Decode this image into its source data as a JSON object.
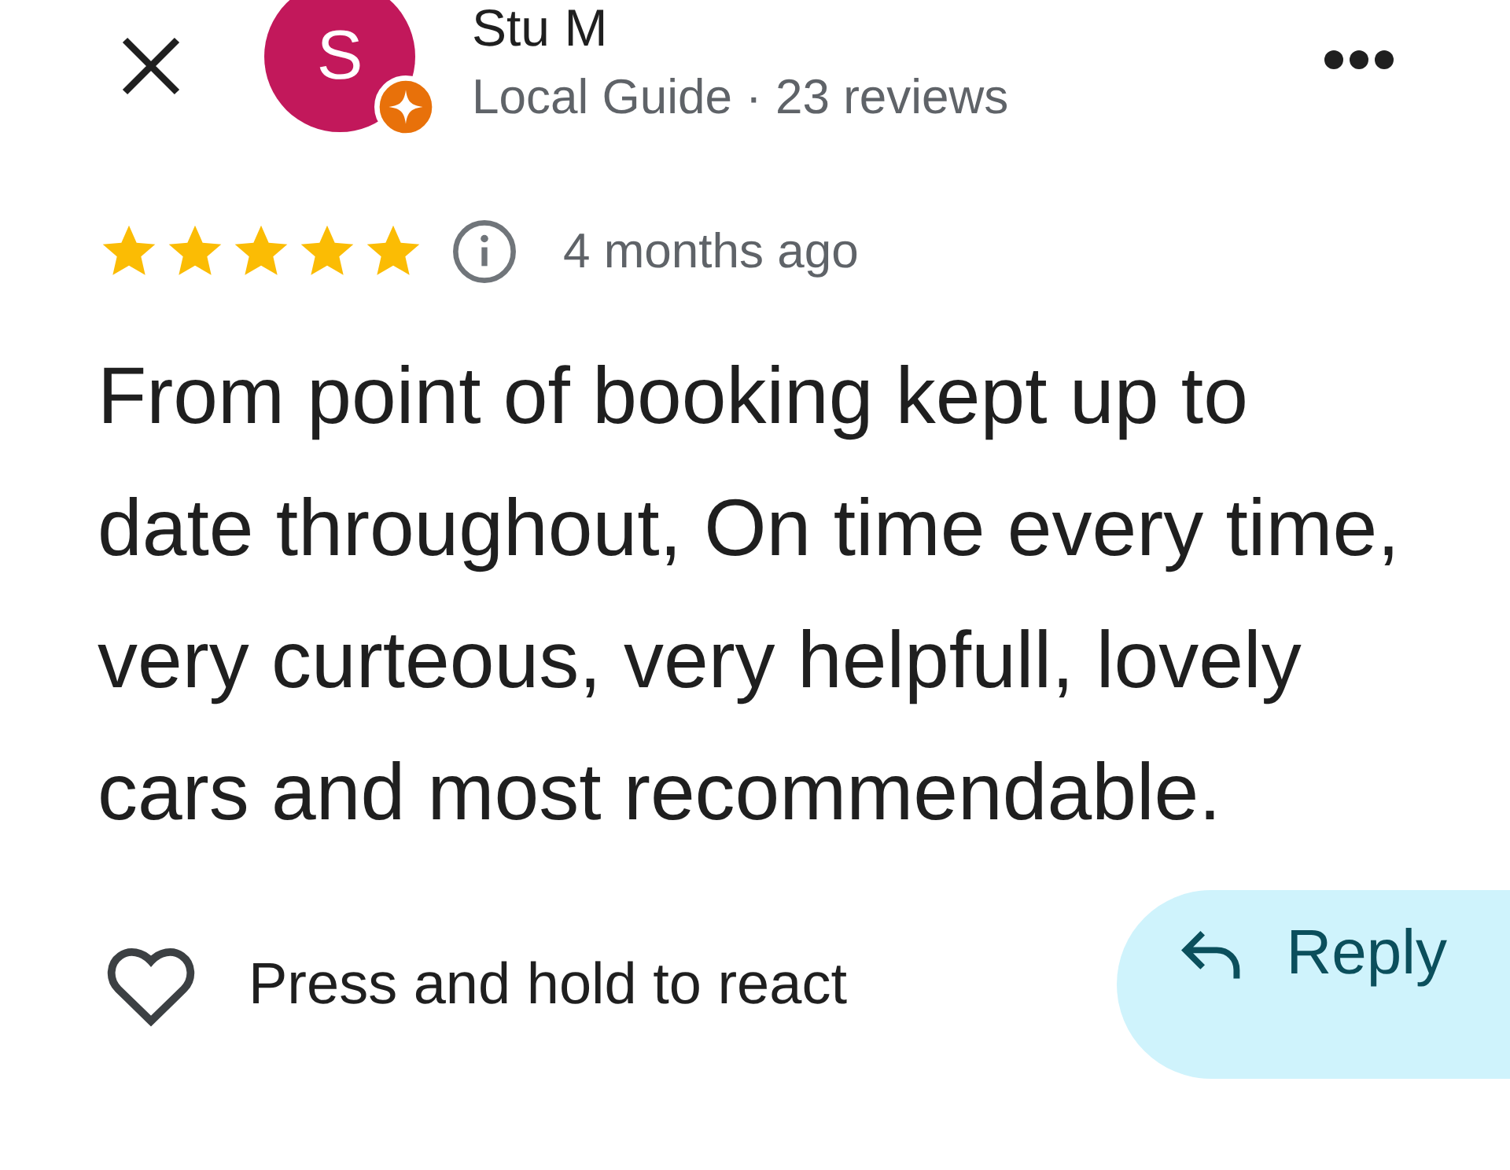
{
  "reviewer": {
    "initial": "S",
    "name": "Stu M",
    "subtitle": "Local Guide · 23 reviews"
  },
  "review": {
    "stars": 5,
    "time": "4 months ago",
    "text": "From point of booking kept up to date throughout, On time every time, very curteous, very helpfull, lovely cars and most recommendable."
  },
  "actions": {
    "react_label": "Press and hold to react",
    "reply_label": "Reply"
  }
}
